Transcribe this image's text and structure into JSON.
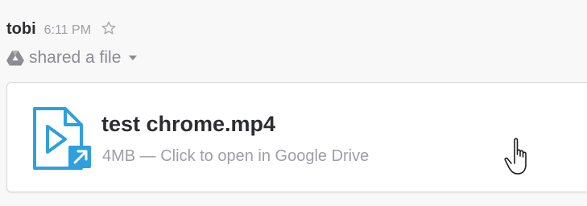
{
  "message": {
    "author": "tobi",
    "time": "6:11 PM",
    "action_text": "shared a file"
  },
  "file": {
    "name": "test chrome.mp4",
    "meta": "4MB — Click to open in Google Drive"
  },
  "icons": {
    "star": "star-outline-icon",
    "drive": "google-drive-icon",
    "caret": "caret-down-icon",
    "file": "video-file-icon",
    "external": "external-link-icon",
    "cursor": "hand-pointer-cursor"
  },
  "colors": {
    "accent": "#2ea0dc",
    "text_primary": "#2c2d30",
    "text_secondary": "#9e9ea6"
  }
}
